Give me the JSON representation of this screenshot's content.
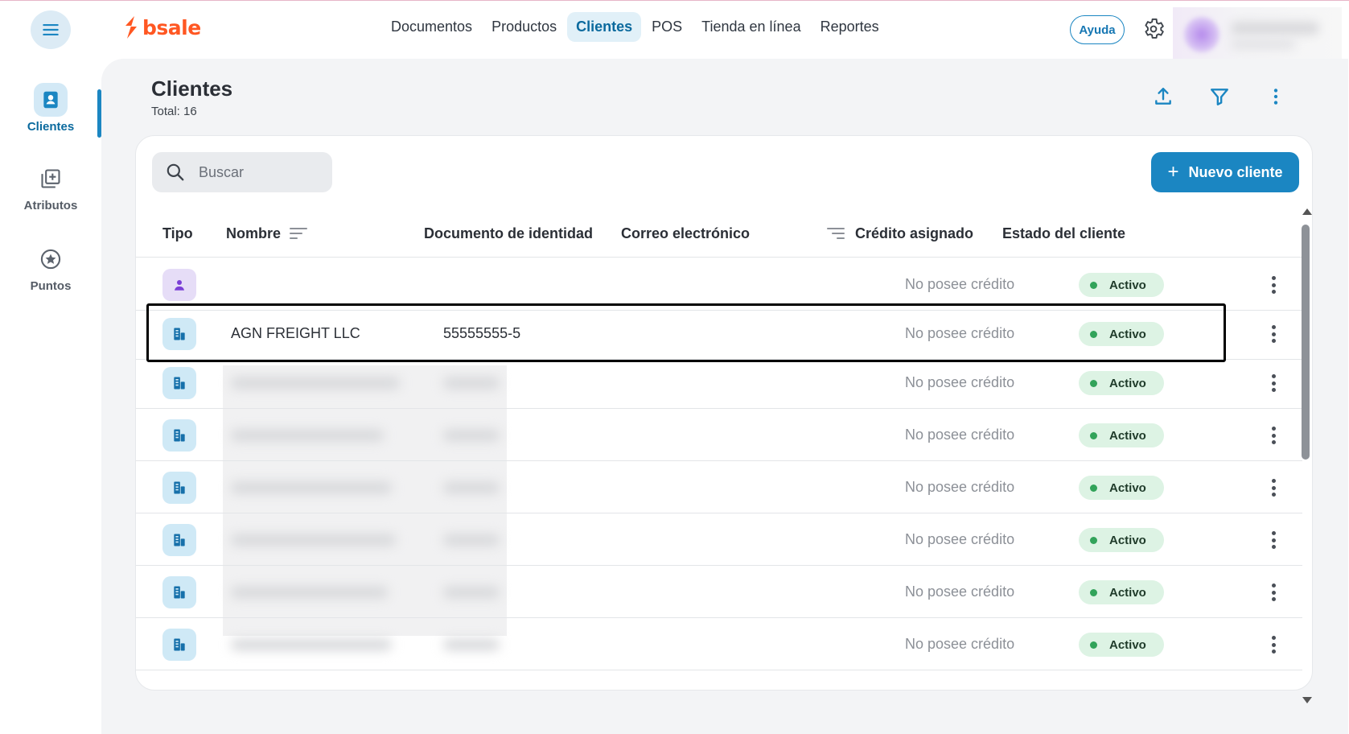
{
  "app": {
    "brand": "bsale"
  },
  "nav": {
    "items": [
      {
        "label": "Documentos",
        "active": false
      },
      {
        "label": "Productos",
        "active": false
      },
      {
        "label": "Clientes",
        "active": true
      },
      {
        "label": "POS",
        "active": false
      },
      {
        "label": "Tienda en línea",
        "active": false
      },
      {
        "label": "Reportes",
        "active": false
      }
    ],
    "help_label": "Ayuda"
  },
  "sidebar": {
    "items": [
      {
        "label": "Clientes",
        "icon": "contact-book-icon",
        "active": true
      },
      {
        "label": "Atributos",
        "icon": "add-box-icon",
        "active": false
      },
      {
        "label": "Puntos",
        "icon": "star-circle-icon",
        "active": false
      }
    ]
  },
  "page": {
    "title": "Clientes",
    "total": "Total: 16"
  },
  "toolbar": {
    "search_placeholder": "Buscar",
    "new_button": "Nuevo cliente",
    "new_button_icon": "+"
  },
  "table": {
    "headers": {
      "type": "Tipo",
      "name": "Nombre",
      "document": "Documento de identidad",
      "email": "Correo electrónico",
      "credit": "Crédito asignado",
      "status": "Estado del cliente"
    },
    "rows": [
      {
        "type": "person",
        "name": "",
        "document": "",
        "email": "",
        "credit": "No posee crédito",
        "status": "Activo"
      },
      {
        "type": "company",
        "name": "AGN FREIGHT LLC",
        "document": "55555555-5",
        "email": "",
        "credit": "No posee crédito",
        "status": "Activo"
      },
      {
        "type": "company",
        "name": "",
        "document": "",
        "email": "",
        "credit": "No posee crédito",
        "status": "Activo"
      },
      {
        "type": "company",
        "name": "",
        "document": "",
        "email": "",
        "credit": "No posee crédito",
        "status": "Activo"
      },
      {
        "type": "company",
        "name": "",
        "document": "",
        "email": "",
        "credit": "No posee crédito",
        "status": "Activo"
      },
      {
        "type": "company",
        "name": "",
        "document": "",
        "email": "",
        "credit": "No posee crédito",
        "status": "Activo"
      },
      {
        "type": "company",
        "name": "",
        "document": "",
        "email": "",
        "credit": "No posee crédito",
        "status": "Activo"
      },
      {
        "type": "company",
        "name": "",
        "document": "",
        "email": "",
        "credit": "No posee crédito",
        "status": "Activo"
      }
    ]
  },
  "colors": {
    "accent": "#1b86c2",
    "brand": "#ff5722",
    "status_active": "#32a35a",
    "status_active_bg": "#ddf3e4"
  }
}
